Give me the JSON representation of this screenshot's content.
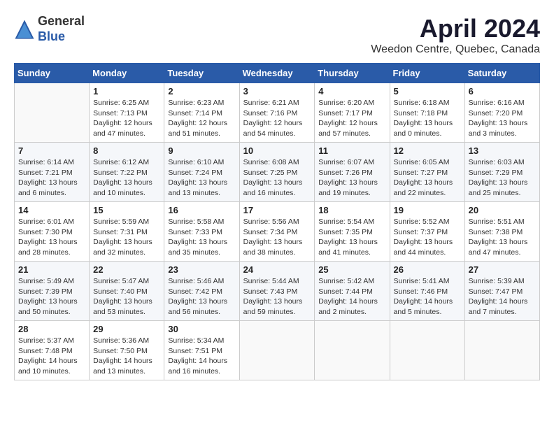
{
  "logo": {
    "line1": "General",
    "line2": "Blue"
  },
  "title": "April 2024",
  "location": "Weedon Centre, Quebec, Canada",
  "days_of_week": [
    "Sunday",
    "Monday",
    "Tuesday",
    "Wednesday",
    "Thursday",
    "Friday",
    "Saturday"
  ],
  "weeks": [
    [
      {
        "day": "",
        "info": ""
      },
      {
        "day": "1",
        "info": "Sunrise: 6:25 AM\nSunset: 7:13 PM\nDaylight: 12 hours\nand 47 minutes."
      },
      {
        "day": "2",
        "info": "Sunrise: 6:23 AM\nSunset: 7:14 PM\nDaylight: 12 hours\nand 51 minutes."
      },
      {
        "day": "3",
        "info": "Sunrise: 6:21 AM\nSunset: 7:16 PM\nDaylight: 12 hours\nand 54 minutes."
      },
      {
        "day": "4",
        "info": "Sunrise: 6:20 AM\nSunset: 7:17 PM\nDaylight: 12 hours\nand 57 minutes."
      },
      {
        "day": "5",
        "info": "Sunrise: 6:18 AM\nSunset: 7:18 PM\nDaylight: 13 hours\nand 0 minutes."
      },
      {
        "day": "6",
        "info": "Sunrise: 6:16 AM\nSunset: 7:20 PM\nDaylight: 13 hours\nand 3 minutes."
      }
    ],
    [
      {
        "day": "7",
        "info": "Sunrise: 6:14 AM\nSunset: 7:21 PM\nDaylight: 13 hours\nand 6 minutes."
      },
      {
        "day": "8",
        "info": "Sunrise: 6:12 AM\nSunset: 7:22 PM\nDaylight: 13 hours\nand 10 minutes."
      },
      {
        "day": "9",
        "info": "Sunrise: 6:10 AM\nSunset: 7:24 PM\nDaylight: 13 hours\nand 13 minutes."
      },
      {
        "day": "10",
        "info": "Sunrise: 6:08 AM\nSunset: 7:25 PM\nDaylight: 13 hours\nand 16 minutes."
      },
      {
        "day": "11",
        "info": "Sunrise: 6:07 AM\nSunset: 7:26 PM\nDaylight: 13 hours\nand 19 minutes."
      },
      {
        "day": "12",
        "info": "Sunrise: 6:05 AM\nSunset: 7:27 PM\nDaylight: 13 hours\nand 22 minutes."
      },
      {
        "day": "13",
        "info": "Sunrise: 6:03 AM\nSunset: 7:29 PM\nDaylight: 13 hours\nand 25 minutes."
      }
    ],
    [
      {
        "day": "14",
        "info": "Sunrise: 6:01 AM\nSunset: 7:30 PM\nDaylight: 13 hours\nand 28 minutes."
      },
      {
        "day": "15",
        "info": "Sunrise: 5:59 AM\nSunset: 7:31 PM\nDaylight: 13 hours\nand 32 minutes."
      },
      {
        "day": "16",
        "info": "Sunrise: 5:58 AM\nSunset: 7:33 PM\nDaylight: 13 hours\nand 35 minutes."
      },
      {
        "day": "17",
        "info": "Sunrise: 5:56 AM\nSunset: 7:34 PM\nDaylight: 13 hours\nand 38 minutes."
      },
      {
        "day": "18",
        "info": "Sunrise: 5:54 AM\nSunset: 7:35 PM\nDaylight: 13 hours\nand 41 minutes."
      },
      {
        "day": "19",
        "info": "Sunrise: 5:52 AM\nSunset: 7:37 PM\nDaylight: 13 hours\nand 44 minutes."
      },
      {
        "day": "20",
        "info": "Sunrise: 5:51 AM\nSunset: 7:38 PM\nDaylight: 13 hours\nand 47 minutes."
      }
    ],
    [
      {
        "day": "21",
        "info": "Sunrise: 5:49 AM\nSunset: 7:39 PM\nDaylight: 13 hours\nand 50 minutes."
      },
      {
        "day": "22",
        "info": "Sunrise: 5:47 AM\nSunset: 7:40 PM\nDaylight: 13 hours\nand 53 minutes."
      },
      {
        "day": "23",
        "info": "Sunrise: 5:46 AM\nSunset: 7:42 PM\nDaylight: 13 hours\nand 56 minutes."
      },
      {
        "day": "24",
        "info": "Sunrise: 5:44 AM\nSunset: 7:43 PM\nDaylight: 13 hours\nand 59 minutes."
      },
      {
        "day": "25",
        "info": "Sunrise: 5:42 AM\nSunset: 7:44 PM\nDaylight: 14 hours\nand 2 minutes."
      },
      {
        "day": "26",
        "info": "Sunrise: 5:41 AM\nSunset: 7:46 PM\nDaylight: 14 hours\nand 5 minutes."
      },
      {
        "day": "27",
        "info": "Sunrise: 5:39 AM\nSunset: 7:47 PM\nDaylight: 14 hours\nand 7 minutes."
      }
    ],
    [
      {
        "day": "28",
        "info": "Sunrise: 5:37 AM\nSunset: 7:48 PM\nDaylight: 14 hours\nand 10 minutes."
      },
      {
        "day": "29",
        "info": "Sunrise: 5:36 AM\nSunset: 7:50 PM\nDaylight: 14 hours\nand 13 minutes."
      },
      {
        "day": "30",
        "info": "Sunrise: 5:34 AM\nSunset: 7:51 PM\nDaylight: 14 hours\nand 16 minutes."
      },
      {
        "day": "",
        "info": ""
      },
      {
        "day": "",
        "info": ""
      },
      {
        "day": "",
        "info": ""
      },
      {
        "day": "",
        "info": ""
      }
    ]
  ]
}
